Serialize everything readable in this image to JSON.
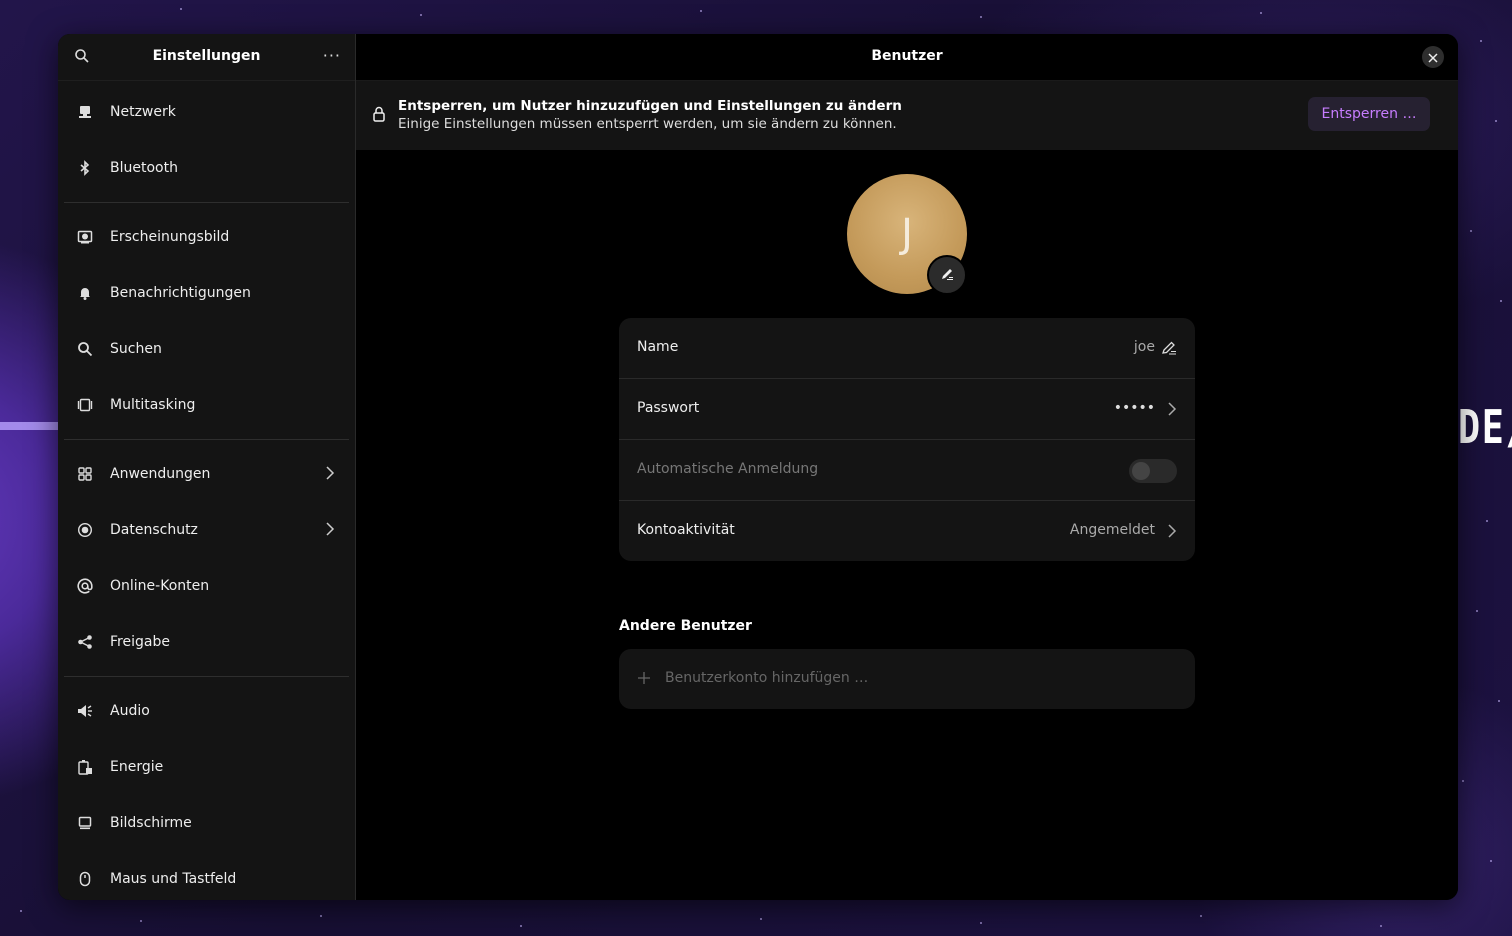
{
  "sidebar": {
    "title": "Einstellungen",
    "menu_label": "···",
    "items": [
      {
        "label": "Netzwerk",
        "icon": "network-icon"
      },
      {
        "label": "Bluetooth",
        "icon": "bluetooth-icon"
      },
      {
        "label": "Erscheinungsbild",
        "icon": "appearance-icon"
      },
      {
        "label": "Benachrichtigungen",
        "icon": "bell-icon"
      },
      {
        "label": "Suchen",
        "icon": "search-icon"
      },
      {
        "label": "Multitasking",
        "icon": "multitasking-icon"
      },
      {
        "label": "Anwendungen",
        "icon": "apps-grid-icon"
      },
      {
        "label": "Datenschutz",
        "icon": "privacy-icon"
      },
      {
        "label": "Online-Konten",
        "icon": "at-sign-icon"
      },
      {
        "label": "Freigabe",
        "icon": "share-icon"
      },
      {
        "label": "Audio",
        "icon": "speaker-icon"
      },
      {
        "label": "Energie",
        "icon": "battery-icon"
      },
      {
        "label": "Bildschirme",
        "icon": "monitor-icon"
      },
      {
        "label": "Maus und Tastfeld",
        "icon": "mouse-icon"
      }
    ]
  },
  "main": {
    "title": "Benutzer",
    "banner": {
      "title": "Entsperren, um Nutzer hinzuzufügen und Einstellungen zu ändern",
      "subtitle": "Einige Einstellungen müssen entsperrt werden, um sie ändern zu können.",
      "button": "Entsperren …"
    },
    "avatar_initial": "J",
    "rows": {
      "name_label": "Name",
      "name_value": "joe",
      "password_label": "Passwort",
      "password_value": "•••••",
      "autologin_label": "Automatische Anmeldung",
      "autologin_enabled": false,
      "activity_label": "Kontoaktivität",
      "activity_value": "Angemeldet"
    },
    "other_users_title": "Andere Benutzer",
    "add_account_label": "Benutzerkonto hinzufügen …"
  },
  "desktop": {
    "wallpaper_text": "DE/"
  },
  "colors": {
    "accent": "#c77dff",
    "window_bg": "#000000",
    "sidebar_bg": "#141414"
  }
}
